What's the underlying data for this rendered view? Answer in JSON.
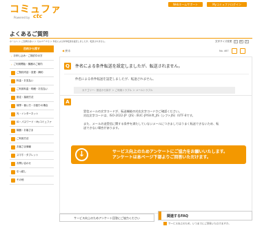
{
  "header": {
    "logo_main": "コミュファ",
    "logo_sub": "Powered by",
    "logo_brand": "ctc",
    "web_support_label": "Webホームサポート",
    "mycommufa_label": "Myコミュファログイン"
  },
  "page_title": "よくあるご質問",
  "breadcrumb": "ホームへ ＞ ご質問の多い ＞ Ｑ＆ＡＦＡＱ ＞ 件名による条件転送を設定しましたが、転送されません。",
  "font_size": {
    "label": "文字サイズ変更",
    "small": "小",
    "medium": "中",
    "large": "大"
  },
  "sidebar": {
    "head": "目的から探す",
    "items": [
      {
        "label": "お申し込み・ご検討中の方",
        "type": "arrow"
      },
      {
        "label": "ご利用開始・機器のご案内",
        "type": "arrow"
      },
      {
        "label": "ご契約内容・変更・解約",
        "type": "icon"
      },
      {
        "label": "料金・お支払い",
        "type": "icon"
      },
      {
        "label": "ご利用料金・明細・お支払い",
        "type": "icon"
      },
      {
        "label": "設定・接続方法",
        "type": "icon"
      },
      {
        "label": "故障・使い方・お困りの場合",
        "type": "icon"
      },
      {
        "label": "光・インターネット",
        "type": "icon"
      },
      {
        "label": "ID・パスワード・Myコミュファ",
        "type": "icon"
      },
      {
        "label": "機器・お客さま",
        "type": "icon"
      },
      {
        "label": "ご利用方法",
        "type": "icon"
      },
      {
        "label": "お客さま情報",
        "type": "icon"
      },
      {
        "label": "スマホ・タブレット",
        "type": "icon"
      },
      {
        "label": "お問い合わせ",
        "type": "icon"
      },
      {
        "label": "引っ越し",
        "type": "icon"
      },
      {
        "label": "その他",
        "type": "icon"
      }
    ]
  },
  "toolbar": {
    "back_label": "戻る",
    "question_no": "No. 467"
  },
  "question": {
    "icon": "Q",
    "title": "件名による条件転送を設定しましたが、転送されません。",
    "body": "件名による条件転送を設定しましたが、転送されません。",
    "category": "カテゴリー：設定から探す ＞ ご利用トラブル ＞ メールトラブル"
  },
  "answer": {
    "icon": "A",
    "lines": [
      "受信メールの文字コードが、転送機能の対応文字コードかご確認ください。",
      "対応文字コードは、ISO-2022-JP（JIS）/EUC-JP/Shift_JIS（シフトJIS）/UTF-8です。",
      "",
      "また、メールの送受信に関する条件を満たしていないメールにつきましてはうまく転送できないため、転",
      "送できない場合があります。"
    ]
  },
  "banner": {
    "line1": "サービス向上のためアンケートにご協力をお願いいたします。",
    "line2": "アンケートは本ページ下部よりご回答いただけます。"
  },
  "survey_label": "サービス向上のためアンケート回答にご協力ください",
  "related": {
    "title": "関連するFAQ",
    "first_question": "サービス向上のため、いつまでにご回答いただけますか。"
  }
}
